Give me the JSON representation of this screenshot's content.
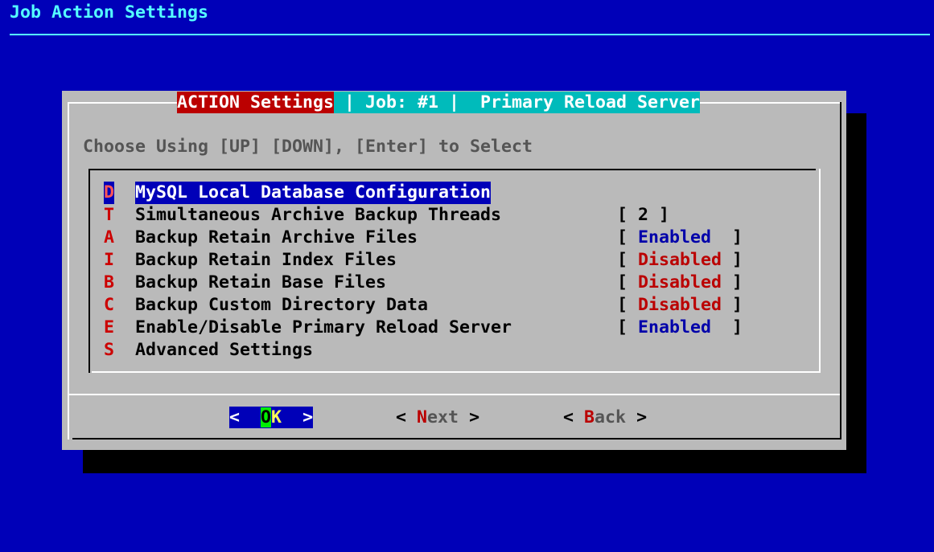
{
  "app_title": "Job Action Settings",
  "dialog": {
    "title_part1": "ACTION Settings",
    "title_part2": " | Job: #1 |  Primary Reload Server",
    "prompt": "Choose Using [UP] [DOWN], [Enter] to Select",
    "items": [
      {
        "key": "D",
        "label": "MySQL Local Database Configuration",
        "value": ""
      },
      {
        "key": "T",
        "label": "Simultaneous Archive Backup Threads",
        "value": "2"
      },
      {
        "key": "A",
        "label": "Backup Retain Archive Files",
        "value": "Enabled"
      },
      {
        "key": "I",
        "label": "Backup Retain Index Files",
        "value": "Disabled"
      },
      {
        "key": "B",
        "label": "Backup Retain Base Files",
        "value": "Disabled"
      },
      {
        "key": "C",
        "label": "Backup Custom Directory Data",
        "value": "Disabled"
      },
      {
        "key": "E",
        "label": "Enable/Disable Primary Reload Server",
        "value": "Enabled"
      },
      {
        "key": "S",
        "label": "Advanced Settings",
        "value": ""
      }
    ],
    "buttons": {
      "ok": {
        "left": "<",
        "hot": "O",
        "rest": "K",
        "right": ">"
      },
      "next": {
        "left": "<",
        "hot": "N",
        "rest": "ext",
        "right": ">"
      },
      "back": {
        "left": "<",
        "hot": "B",
        "rest": "ack",
        "right": ">"
      }
    }
  },
  "colors": {
    "background": "#0000b8",
    "dialog": "#bababa",
    "title_red": "#bb0000",
    "title_cyan": "#00bbbb",
    "enabled": "#0000aa",
    "disabled": "#bb0000"
  }
}
